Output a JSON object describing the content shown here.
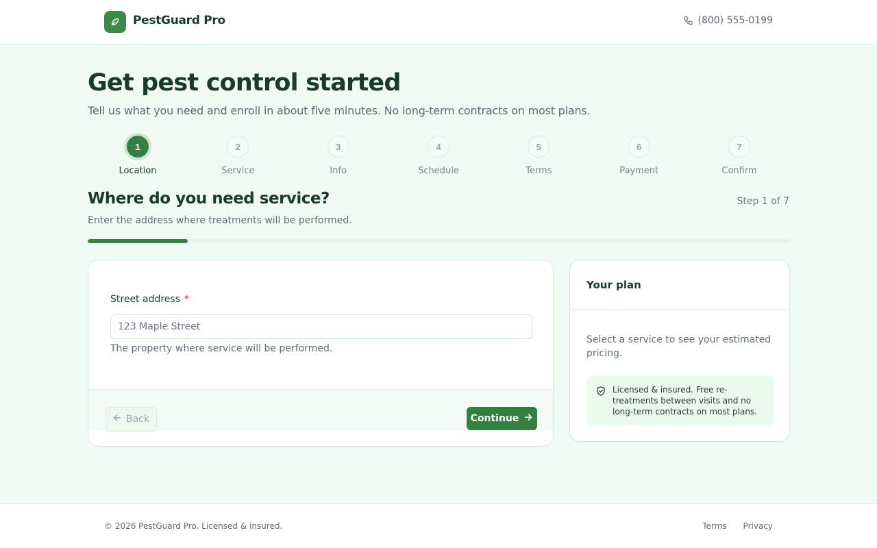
{
  "header": {
    "brand": "PestGuard Pro",
    "phone": "(800) 555-0199"
  },
  "hero": {
    "title": "Get pest control started",
    "subtitle": "Tell us what you need and enroll in about five minutes. No long-term contracts on most plans."
  },
  "stepper": {
    "current": 1,
    "steps": [
      {
        "number": "1",
        "label": "Location"
      },
      {
        "number": "2",
        "label": "Service"
      },
      {
        "number": "3",
        "label": "Info"
      },
      {
        "number": "4",
        "label": "Schedule"
      },
      {
        "number": "5",
        "label": "Terms"
      },
      {
        "number": "6",
        "label": "Payment"
      },
      {
        "number": "7",
        "label": "Confirm"
      }
    ]
  },
  "section": {
    "title": "Where do you need service?",
    "step_count": "Step 1 of 7",
    "subtitle": "Enter the address where treatments will be performed.",
    "progress_fraction": 0.1429
  },
  "form": {
    "street_label": "Street address",
    "required_mark": "*",
    "street_value": "",
    "street_placeholder": "123 Maple Street",
    "street_help": "The property where service will be performed.",
    "back_label": "Back",
    "continue_label": "Continue"
  },
  "plan": {
    "title": "Your plan",
    "description": "Select a service to see your estimated pricing.",
    "notice": "Licensed & insured. Free re-treatments between visits and no long-term contracts on most plans."
  },
  "footer": {
    "copyright": "© 2026 PestGuard Pro. Licensed & insured.",
    "links": [
      "Terms",
      "Privacy"
    ]
  },
  "colors": {
    "brand": "#338040",
    "page_bg": "#f0fbf3",
    "heading": "#1b3b2a",
    "required": "#d32f2f"
  },
  "icons": {
    "logo": "leaf-icon",
    "phone": "phone-icon",
    "back": "arrow-left-icon",
    "continue": "arrow-right-icon",
    "notice": "shield-check-icon"
  }
}
